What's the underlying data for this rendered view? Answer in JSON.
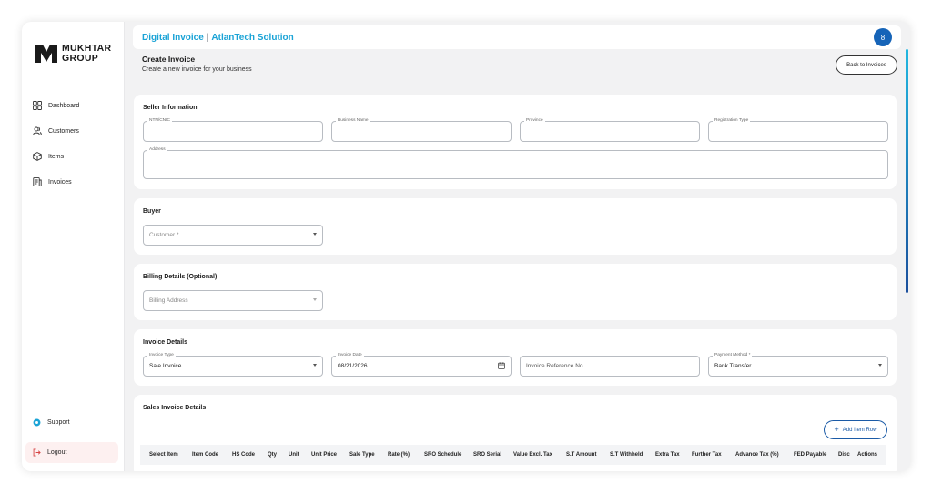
{
  "brand": {
    "line1": "MUKHTAR",
    "line2": "GROUP"
  },
  "sidebar": {
    "items": [
      {
        "label": "Dashboard",
        "icon": "dashboard-grid-icon"
      },
      {
        "label": "Customers",
        "icon": "users-icon"
      },
      {
        "label": "Items",
        "icon": "box-icon"
      },
      {
        "label": "Invoices",
        "icon": "invoice-icon"
      }
    ],
    "support": "Support",
    "logout": "Logout"
  },
  "topbar": {
    "app_name": "Digital Invoice",
    "separator": "|",
    "company": "AtlanTech Solution",
    "avatar_initial": "8"
  },
  "page": {
    "title": "Create Invoice",
    "subtitle": "Create a new invoice for your business",
    "back_button": "Back to Invoices"
  },
  "seller": {
    "title": "Seller Information",
    "fields": {
      "ntn": "NTN/CNIC",
      "business_name": "Business Name",
      "province": "Province",
      "registration_type": "Registration Type",
      "address": "Address"
    }
  },
  "buyer": {
    "title": "Buyer",
    "customer_placeholder": "Customer *"
  },
  "billing": {
    "title": "Billing Details (Optional)",
    "address_placeholder": "Billing Address"
  },
  "invoice_details": {
    "title": "Invoice Details",
    "invoice_type_label": "Invoice Type",
    "invoice_type_value": "Sale Invoice",
    "invoice_date_label": "Invoice Date",
    "invoice_date_value": "08/21/2026",
    "reference_placeholder": "Invoice Reference No",
    "payment_method_label": "Payment Method *",
    "payment_method_value": "Bank Transfer"
  },
  "sales_details": {
    "title": "Sales Invoice Details",
    "add_button": "Add Item Row",
    "columns": [
      "Select Item",
      "Item Code",
      "HS Code",
      "Qty",
      "Unit",
      "Unit Price",
      "Sale Type",
      "Rate (%)",
      "SRO Schedule",
      "SRO Serial",
      "Value Excl. Tax",
      "S.T Amount",
      "S.T Withheld",
      "Extra Tax",
      "Further Tax",
      "Advance Tax (%)",
      "FED Payable",
      "Disc",
      "Actions"
    ]
  },
  "colors": {
    "accent": "#1aa3d6",
    "primary": "#1664b8",
    "logout_bg": "#fdf0f0"
  }
}
